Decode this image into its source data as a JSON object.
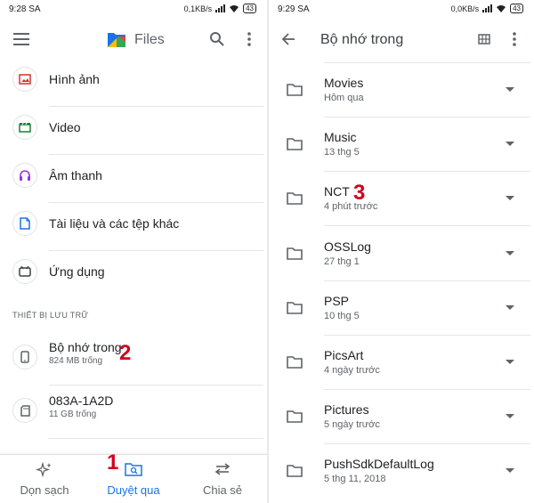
{
  "left": {
    "status": {
      "time": "9:28 SA",
      "network_speed": "0,1KB/s",
      "battery": "43"
    },
    "appbar": {
      "title": "Files",
      "menu_icon": "menu-icon",
      "search_icon": "search-icon",
      "more_icon": "more-vert-icon"
    },
    "categories": [
      {
        "label": "Hình ảnh",
        "icon": "image-icon",
        "color": "#d93025"
      },
      {
        "label": "Video",
        "icon": "video-icon",
        "color": "#188038"
      },
      {
        "label": "Âm thanh",
        "icon": "headphones-icon",
        "color": "#9334e6"
      },
      {
        "label": "Tài liệu và các tệp khác",
        "icon": "document-icon",
        "color": "#1a73e8"
      },
      {
        "label": "Ứng dụng",
        "icon": "apps-icon",
        "color": "#3c4043"
      }
    ],
    "storage_section_title": "THIẾT BỊ LƯU TRỮ",
    "storage": [
      {
        "name": "Bộ nhớ trong",
        "sub": "824 MB trống",
        "icon": "phone-icon"
      },
      {
        "name": "083A-1A2D",
        "sub": "11 GB trống",
        "icon": "sd-card-icon"
      }
    ],
    "bottom_nav": [
      {
        "label": "Dọn sạch",
        "icon": "sparkle-icon",
        "active": false
      },
      {
        "label": "Duyệt qua",
        "icon": "browse-folder-icon",
        "active": true
      },
      {
        "label": "Chia sẻ",
        "icon": "swap-arrows-icon",
        "active": false
      }
    ],
    "step_labels": {
      "bottom_nav": "1",
      "storage": "2"
    }
  },
  "right": {
    "status": {
      "time": "9:29 SA",
      "network_speed": "0,0KB/s",
      "battery": "43"
    },
    "appbar": {
      "title": "Bộ nhớ trong",
      "back_icon": "arrow-back-icon",
      "grid_icon": "grid-view-icon",
      "more_icon": "more-vert-icon"
    },
    "folders": [
      {
        "name": "Movies",
        "date": "Hôm qua"
      },
      {
        "name": "Music",
        "date": "13 thg 5"
      },
      {
        "name": "NCT",
        "date": "4 phút trước"
      },
      {
        "name": "OSSLog",
        "date": "27 thg 1"
      },
      {
        "name": "PSP",
        "date": "10 thg 5"
      },
      {
        "name": "PicsArt",
        "date": "4 ngày trước"
      },
      {
        "name": "Pictures",
        "date": "5 ngày trước"
      },
      {
        "name": "PushSdkDefaultLog",
        "date": "5 thg 11, 2018"
      }
    ],
    "step_label": "3"
  },
  "colors": {
    "accent": "#1a73e8",
    "step_number": "#d0021b",
    "text_secondary": "#5f6368"
  }
}
